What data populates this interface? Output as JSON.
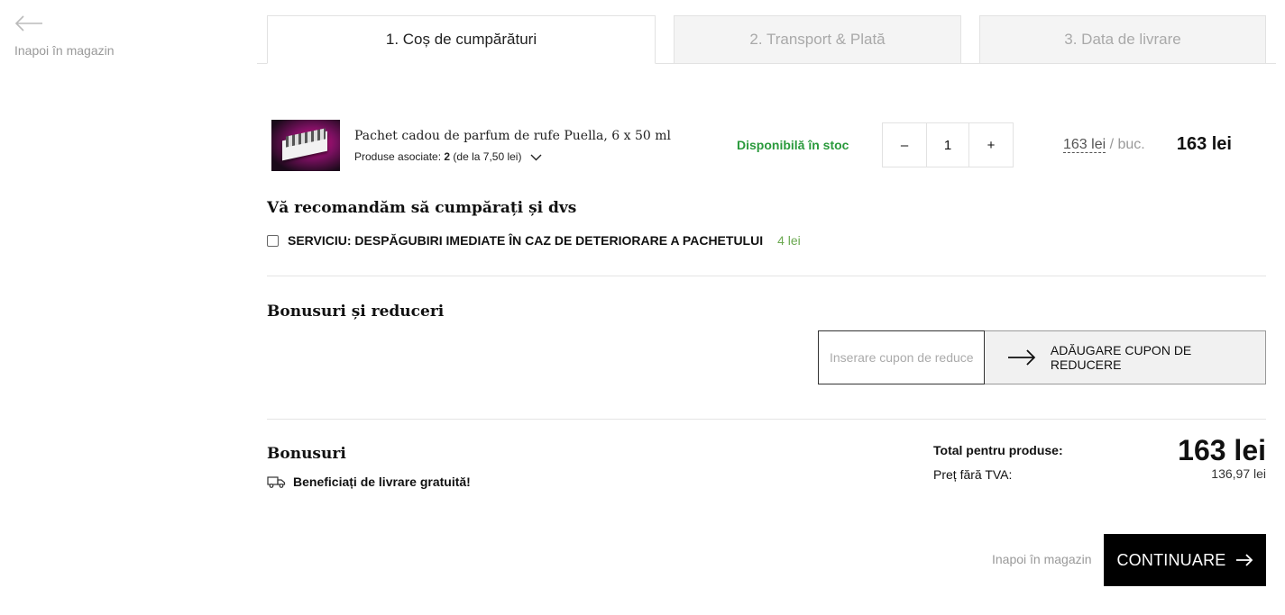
{
  "nav": {
    "back_label": "Inapoi în magazin"
  },
  "tabs": [
    {
      "label": "1. Coș de cumpărături",
      "active": true
    },
    {
      "label": "2. Transport & Plată",
      "active": false
    },
    {
      "label": "3. Data de livrare",
      "active": false
    }
  ],
  "product": {
    "name": "Pachet cadou de parfum de rufe Puella, 6 x 50 ml",
    "assoc_prefix": "Produse asociate: ",
    "assoc_count": "2",
    "assoc_suffix": " (de la 7,50 lei)",
    "stock": "Disponibilă în stoc",
    "qty_minus": "–",
    "quantity": "1",
    "qty_plus": "+",
    "unit_price": "163 lei",
    "unit_suffix": " / buc.",
    "line_total": "163 lei"
  },
  "recommend": {
    "title": "Vă recomandăm să cumpărați și dvs",
    "service_label": "SERVICIU: DESPĂGUBIRI IMEDIATE ÎN CAZ DE DETERIORARE A PACHETULUI",
    "service_price": "4 lei",
    "checked": false
  },
  "discounts": {
    "title": "Bonusuri și reduceri",
    "coupon_placeholder": "Inserare cupon de reducere",
    "coupon_button": "ADĂUGARE CUPON DE REDUCERE"
  },
  "bonus": {
    "title": "Bonusuri",
    "free_delivery": "Beneficiați de livrare gratuită!"
  },
  "totals": {
    "total_label": "Total pentru produse:",
    "total_value": "163 lei",
    "net_label": "Preț fără TVA:",
    "net_value": "136,97 lei"
  },
  "footer": {
    "back_label": "Inapoi în magazin",
    "continue_label": "CONTINUARE"
  },
  "colors": {
    "stock_green": "#2a9a3c",
    "price_green": "#6aa84f",
    "primary_button": "#000000"
  }
}
